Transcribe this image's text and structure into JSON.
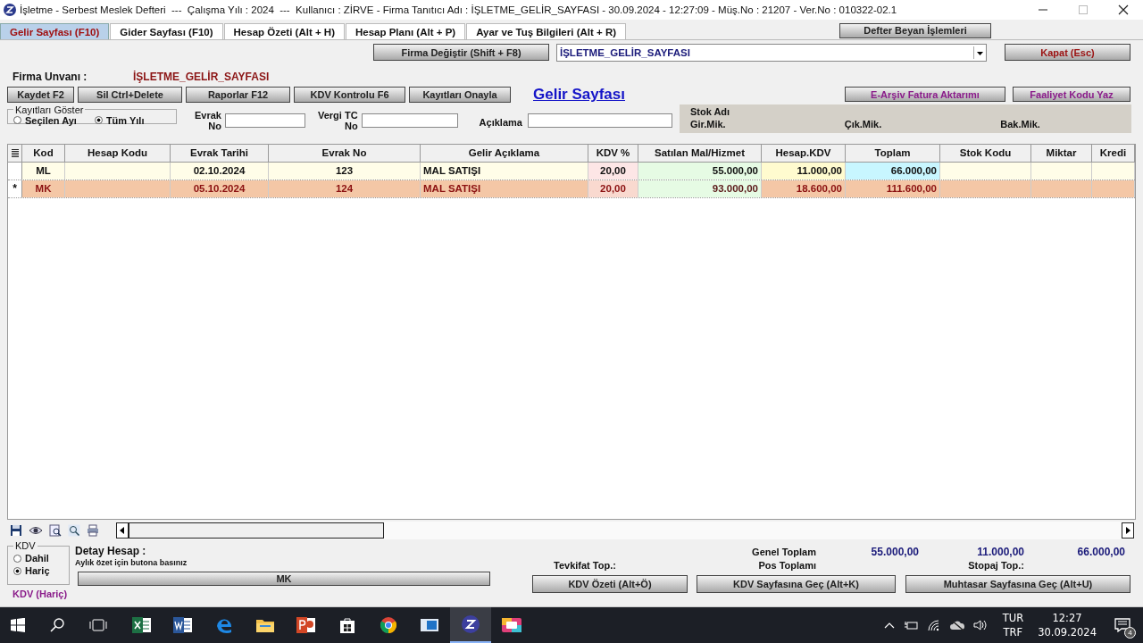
{
  "window": {
    "title": "İşletme - Serbest Meslek Defteri  ---  Çalışma Yılı : 2024  ---  Kullanıcı : ZİRVE - Firma Tanıtıcı Adı : İŞLETME_GELİR_SAYFASI - 30.09.2024 - 12:27:09 - Müş.No : 21207 - Ver.No : 010322-02.1"
  },
  "tabs": [
    {
      "label": "Gelir Sayfası (F10)",
      "selected": true
    },
    {
      "label": "Gider Sayfası (F10)",
      "selected": false
    },
    {
      "label": "Hesap Özeti (Alt + H)",
      "selected": false
    },
    {
      "label": "Hesap Planı (Alt + P)",
      "selected": false
    },
    {
      "label": "Ayar ve Tuş Bilgileri (Alt + R)",
      "selected": false
    }
  ],
  "defter_beyan_button": "Defter Beyan İşlemleri",
  "firma_degistir_button": "Firma Değiştir (Shift + F8)",
  "firma_select": {
    "value": "İŞLETME_GELİR_SAYFASI"
  },
  "kapat_button": "Kapat (Esc)",
  "firma_unvani": {
    "label": "Firma Unvanı :",
    "value": "İŞLETME_GELİR_SAYFASI"
  },
  "toolbar_buttons": [
    "Kaydet F2",
    "Sil Ctrl+Delete",
    "Raporlar F12",
    "KDV Kontrolu F6",
    "Kayıtları Onayla"
  ],
  "page_title": "Gelir Sayfası",
  "right_buttons": [
    "E-Arşiv Fatura Aktarımı",
    "Faaliyet Kodu Yaz"
  ],
  "kayitlari_goster": {
    "title": "Kayıtları Göster",
    "options": [
      {
        "label": "Seçilen Ayı",
        "selected": false
      },
      {
        "label": "Tüm Yılı",
        "selected": true
      }
    ]
  },
  "filters": [
    {
      "label_top": "Evrak",
      "label_bottom": "No"
    },
    {
      "label_top": "Vergi TC",
      "label_bottom": "No"
    }
  ],
  "aciklama_label": "Açıklama",
  "stok_panel": {
    "title": "Stok Adı",
    "labels": [
      "Gir.Mik.",
      "Çık.Mik.",
      "Bak.Mik."
    ]
  },
  "table": {
    "columns": [
      "Kod",
      "Hesap Kodu",
      "Evrak Tarihi",
      "Evrak No",
      "Gelir Açıklama",
      "KDV %",
      "Satılan Mal/Hizmet",
      "Hesap.KDV",
      "Toplam",
      "Stok Kodu",
      "Miktar",
      "Kredi"
    ],
    "rows": [
      {
        "kod": "ML",
        "evrak_tarihi": "02.10.2024",
        "evrak_no": "123",
        "gelir_aciklama": "MAL SATIŞI",
        "kdv_orani": "20,00",
        "satilan": "55.000,00",
        "hesap_kdv": "11.000,00",
        "toplam": "66.000,00",
        "selected": false
      },
      {
        "marker": "*",
        "kod": "MK",
        "evrak_tarihi": "05.10.2024",
        "evrak_no": "124",
        "gelir_aciklama": "MAL SATIŞI",
        "kdv_orani": "20,00",
        "satilan": "93.000,00",
        "hesap_kdv": "18.600,00",
        "toplam": "111.600,00",
        "selected": true
      }
    ]
  },
  "kdv_group": {
    "title": "KDV",
    "options": [
      {
        "label": "Dahil",
        "selected": false
      },
      {
        "label": "Hariç",
        "selected": true
      }
    ],
    "status": "KDV (Hariç)"
  },
  "detay": {
    "label": "Detay Hesap :",
    "hint": "Aylık özet için butona basınız",
    "button": "MK"
  },
  "totals": {
    "tevkifat_label": "Tevkifat  Top.:",
    "genel_label": "Genel Toplam",
    "pos_label": "Pos Toplamı",
    "stopaj_label": "Stopaj  Top.:",
    "values": [
      "55.000,00",
      "11.000,00",
      "66.000,00"
    ]
  },
  "bottom_buttons": [
    "KDV Özeti (Alt+Ö)",
    "KDV Sayfasına Geç (Alt+K)",
    "Muhtasar Sayfasına Geç (Alt+U)"
  ],
  "taskbar": {
    "language": [
      "TUR",
      "TRF"
    ],
    "time": "12:27",
    "date": "30.09.2024",
    "notifications": "4"
  }
}
